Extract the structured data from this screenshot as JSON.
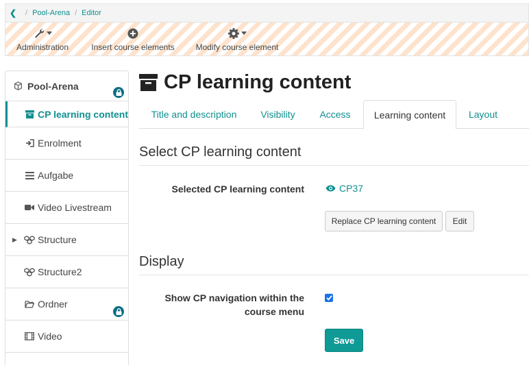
{
  "breadcrumb": {
    "items": [
      "Pool-Arena",
      "Editor"
    ]
  },
  "toolbar": {
    "administration": "Administration",
    "insert": "Insert course elements",
    "modify": "Modify course element"
  },
  "sidebar": {
    "root": "Pool-Arena",
    "items": [
      {
        "label": "CP learning content",
        "icon": "archive-icon"
      },
      {
        "label": "Enrolment",
        "icon": "sign-in-icon"
      },
      {
        "label": "Aufgabe",
        "icon": "list-icon"
      },
      {
        "label": "Video Livestream",
        "icon": "video-camera-icon"
      },
      {
        "label": "Structure",
        "icon": "cubes-icon"
      },
      {
        "label": "Structure2",
        "icon": "cubes-icon"
      },
      {
        "label": "Ordner",
        "icon": "folder-open-icon"
      },
      {
        "label": "Video",
        "icon": "film-icon"
      }
    ]
  },
  "page": {
    "title": "CP learning content"
  },
  "tabs": [
    "Title and description",
    "Visibility",
    "Access",
    "Learning content",
    "Layout"
  ],
  "active_tab": "Learning content",
  "section1": {
    "title": "Select CP learning content",
    "field_label": "Selected CP learning content",
    "value": "CP37",
    "replace_button": "Replace CP learning content",
    "edit_button": "Edit"
  },
  "section2": {
    "title": "Display",
    "nav_label": "Show CP navigation within the course menu",
    "nav_checked": true
  },
  "save_button": "Save",
  "colors": {
    "accent": "#0f8f8f",
    "lock": "#0f6d85",
    "save": "#0f9a96",
    "stripe": "#fde3cd"
  }
}
